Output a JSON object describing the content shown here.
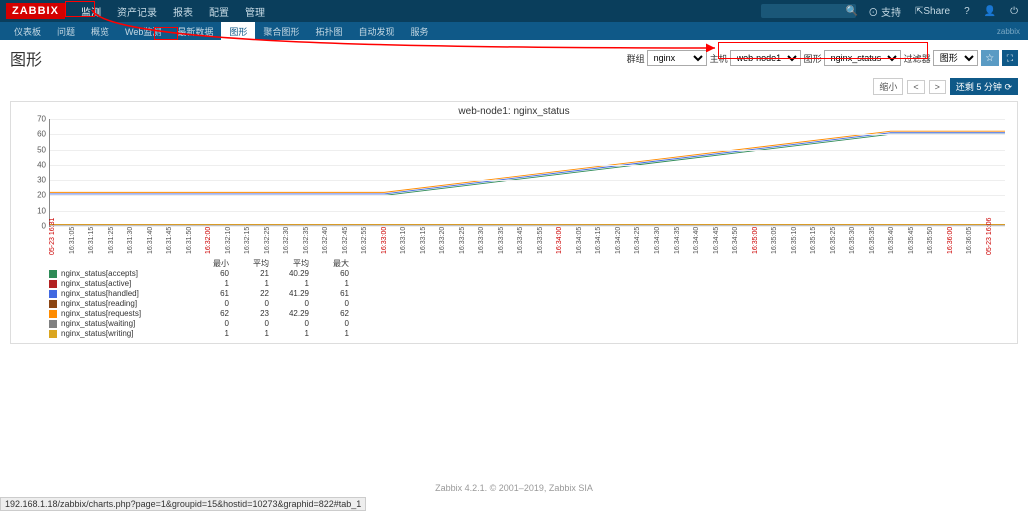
{
  "logo": "ZABBIX",
  "nav1": [
    "监测",
    "资产记录",
    "报表",
    "配置",
    "管理"
  ],
  "nav1_active": 0,
  "nav2": [
    "仪表板",
    "问题",
    "概览",
    "Web监测",
    "最新数据",
    "图形",
    "聚合图形",
    "拓扑图",
    "自动发现",
    "服务"
  ],
  "nav2_active": 5,
  "zlabel": "zabbix",
  "tb": {
    "support": "⊙ 支持",
    "share": "⇱Share",
    "q": "?",
    "user": "👤",
    "logout": "⏻"
  },
  "page_title": "图形",
  "filters": {
    "group_label": "群组",
    "group_value": "nginx",
    "host_label": "主机",
    "host_value": "web-node1",
    "graph_label": "图形",
    "graph_value": "nginx_status",
    "view_label": "过滤器",
    "view_value": "图形"
  },
  "btn_star": "☆",
  "btn_full": "⛶",
  "controls": {
    "shrink": "缩小",
    "left": "<",
    "right": ">",
    "remain": "还剩 5 分钟",
    "refresh": "⟳"
  },
  "chart_data": {
    "type": "line",
    "title": "web-node1: nginx_status",
    "ylim": [
      0,
      70
    ],
    "yticks": [
      0,
      10,
      20,
      30,
      40,
      50,
      60,
      70
    ],
    "x_ticks": [
      {
        "l": "05-23 16:31",
        "r": true
      },
      {
        "l": "16:31:05"
      },
      {
        "l": "16:31:15"
      },
      {
        "l": "16:31:25"
      },
      {
        "l": "16:31:30"
      },
      {
        "l": "16:31:40"
      },
      {
        "l": "16:31:45"
      },
      {
        "l": "16:31:50"
      },
      {
        "l": "16:32:00",
        "r": true
      },
      {
        "l": "16:32:10"
      },
      {
        "l": "16:32:15"
      },
      {
        "l": "16:32:25"
      },
      {
        "l": "16:32:30"
      },
      {
        "l": "16:32:35"
      },
      {
        "l": "16:32:40"
      },
      {
        "l": "16:32:45"
      },
      {
        "l": "16:32:55"
      },
      {
        "l": "16:33:00",
        "r": true
      },
      {
        "l": "16:33:10"
      },
      {
        "l": "16:33:15"
      },
      {
        "l": "16:33:20"
      },
      {
        "l": "16:33:25"
      },
      {
        "l": "16:33:30"
      },
      {
        "l": "16:33:35"
      },
      {
        "l": "16:33:45"
      },
      {
        "l": "16:33:55"
      },
      {
        "l": "16:34:00",
        "r": true
      },
      {
        "l": "16:34:05"
      },
      {
        "l": "16:34:15"
      },
      {
        "l": "16:34:20"
      },
      {
        "l": "16:34:25"
      },
      {
        "l": "16:34:30"
      },
      {
        "l": "16:34:35"
      },
      {
        "l": "16:34:40"
      },
      {
        "l": "16:34:45"
      },
      {
        "l": "16:34:50"
      },
      {
        "l": "16:35:00",
        "r": true
      },
      {
        "l": "16:35:05"
      },
      {
        "l": "16:35:10"
      },
      {
        "l": "16:35:15"
      },
      {
        "l": "16:35:25"
      },
      {
        "l": "16:35:30"
      },
      {
        "l": "16:35:35"
      },
      {
        "l": "16:35:40"
      },
      {
        "l": "16:35:45"
      },
      {
        "l": "16:35:50"
      },
      {
        "l": "16:36:00",
        "r": true
      },
      {
        "l": "16:36:05"
      },
      {
        "l": "05-23 16:06",
        "r": true
      }
    ],
    "series": [
      {
        "name": "nginx_status[accepts]",
        "color": "#2e8b57",
        "min": 60,
        "avg": 21,
        "mean": 40.29,
        "max": 60,
        "line": [
          [
            0,
            20
          ],
          [
            35,
            20
          ],
          [
            88,
            60
          ],
          [
            100,
            60
          ]
        ]
      },
      {
        "name": "nginx_status[active]",
        "color": "#b22222",
        "min": 1,
        "avg": 1,
        "mean": 1,
        "max": 1,
        "line": [
          [
            0,
            1
          ],
          [
            100,
            1
          ]
        ]
      },
      {
        "name": "nginx_status[handled]",
        "color": "#4169e1",
        "min": 61,
        "avg": 22,
        "mean": 41.29,
        "max": 61,
        "line": [
          [
            0,
            21
          ],
          [
            35,
            21
          ],
          [
            88,
            61
          ],
          [
            100,
            61
          ]
        ]
      },
      {
        "name": "nginx_status[reading]",
        "color": "#8b4513",
        "min": 0,
        "avg": 0,
        "mean": 0,
        "max": 0,
        "line": [
          [
            0,
            0
          ],
          [
            100,
            0
          ]
        ]
      },
      {
        "name": "nginx_status[requests]",
        "color": "#ff8c00",
        "min": 62,
        "avg": 23,
        "mean": 42.29,
        "max": 62,
        "line": [
          [
            0,
            22
          ],
          [
            35,
            22
          ],
          [
            88,
            62
          ],
          [
            100,
            62
          ]
        ]
      },
      {
        "name": "nginx_status[waiting]",
        "color": "#808080",
        "min": 0,
        "avg": 0,
        "mean": 0,
        "max": 0,
        "line": [
          [
            0,
            0
          ],
          [
            100,
            0
          ]
        ]
      },
      {
        "name": "nginx_status[writing]",
        "color": "#daa520",
        "min": 1,
        "avg": 1,
        "mean": 1,
        "max": 1,
        "line": [
          [
            0,
            1
          ],
          [
            100,
            1
          ]
        ]
      }
    ],
    "legend_headers": [
      "最小",
      "平均",
      "平均",
      "最大"
    ]
  },
  "footer": "Zabbix 4.2.1. © 2001–2019, Zabbix SIA",
  "status_url": "192.168.1.18/zabbix/charts.php?page=1&groupid=15&hostid=10273&graphid=822#tab_1"
}
